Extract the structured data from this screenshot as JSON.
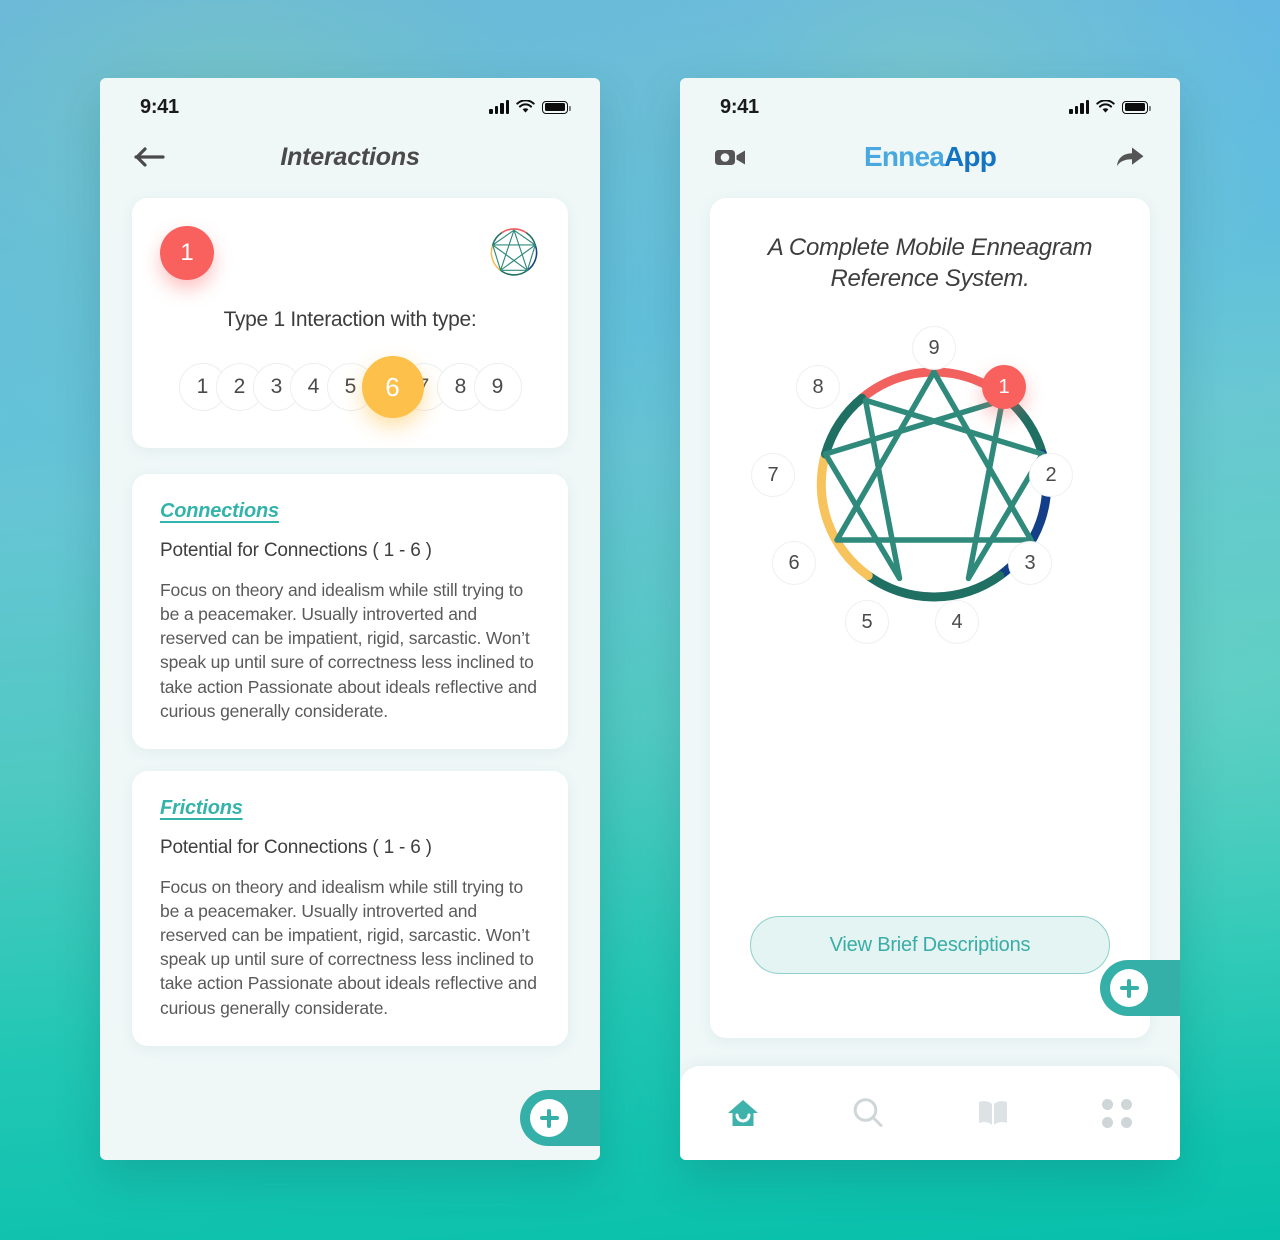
{
  "background": {
    "top_color": "#63b2e8",
    "bottom_color": "#06c0ab"
  },
  "colors": {
    "accent_red": "#F9615F",
    "accent_yellow": "#FCC04B",
    "accent_teal": "#34B0A8",
    "accent_blue_dark": "#123F88",
    "link_teal": "#34B3AB",
    "screen_bg": "#EFF8F7"
  },
  "left_phone": {
    "status_bar": {
      "time": "9:41",
      "signal_icon": "cellular-bars-icon",
      "wifi_icon": "wifi-icon",
      "battery_icon": "battery-full-icon"
    },
    "nav": {
      "back_icon": "back-arrow-icon",
      "title": "Interactions"
    },
    "type_card": {
      "badge_number": "1",
      "enneagram_icon": "enneagram-icon",
      "prompt": "Type 1 Interaction with type:",
      "types": [
        "1",
        "2",
        "3",
        "4",
        "5",
        "6",
        "7",
        "8",
        "9"
      ],
      "selected_type": "6"
    },
    "sections": [
      {
        "title": "Connections",
        "subtitle": "Potential for Connections ( 1 - 6 )",
        "body": "Focus on theory and idealism while still trying to be a peacemaker. Usually introverted and reserved can be impatient, rigid, sarcastic. Won’t speak up until sure of correctness less inclined to take action Passionate about ideals reflective and curious generally considerate."
      },
      {
        "title": "Frictions",
        "subtitle": "Potential for Connections ( 1 - 6 )",
        "body": "Focus on theory and idealism while still trying to be a peacemaker. Usually introverted and reserved can be impatient, rigid, sarcastic. Won’t speak up until sure of correctness less inclined to take action Passionate about ideals reflective and curious generally considerate."
      }
    ],
    "fab": {
      "icon": "plus-icon"
    }
  },
  "right_phone": {
    "status_bar": {
      "time": "9:41",
      "signal_icon": "cellular-bars-icon",
      "wifi_icon": "wifi-icon",
      "battery_icon": "battery-full-icon"
    },
    "nav": {
      "video_icon": "video-camera-icon",
      "brand_part1": "Ennea",
      "brand_part2": "App",
      "share_icon": "share-arrow-icon"
    },
    "hero": {
      "tagline_line1": "A Complete Mobile Enneagram",
      "tagline_line2": "Reference System.",
      "enneagram_nodes": [
        "1",
        "2",
        "3",
        "4",
        "5",
        "6",
        "7",
        "8",
        "9"
      ],
      "selected_node": "1",
      "cta_label": "View Brief Descriptions"
    },
    "fab": {
      "icon": "plus-icon"
    },
    "tabbar": [
      {
        "icon": "home-icon",
        "active": true
      },
      {
        "icon": "search-icon",
        "active": false
      },
      {
        "icon": "book-icon",
        "active": false
      },
      {
        "icon": "grid-dots-icon",
        "active": false
      }
    ]
  }
}
